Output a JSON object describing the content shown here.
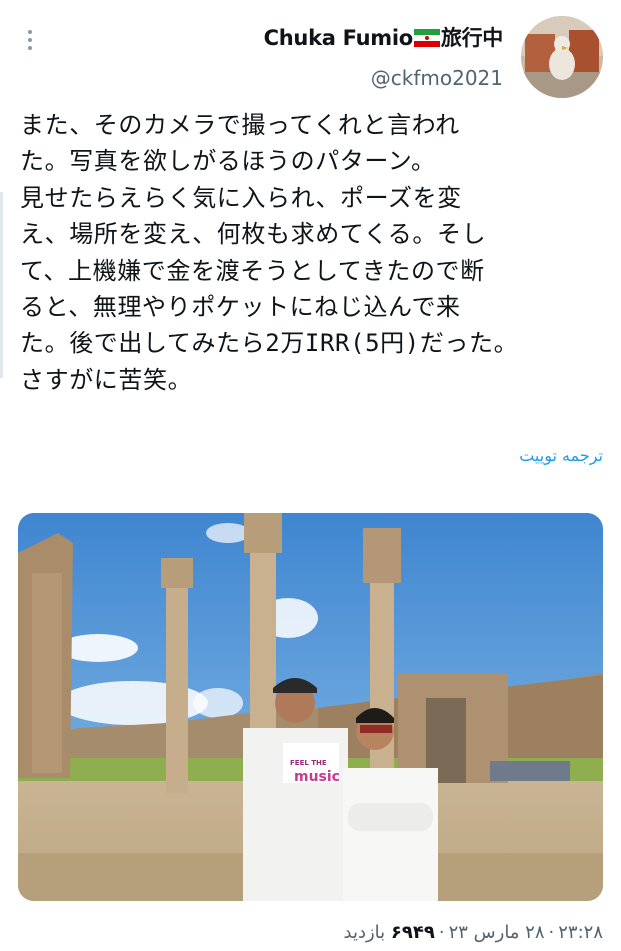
{
  "author": {
    "display_name": "Chuka Fumio",
    "display_suffix": "旅行中",
    "flag_icon": "iran-flag-icon",
    "handle": "@ckfmo2021"
  },
  "tweet": {
    "lines": [
      "また、そのカメラで撮ってくれと言われ",
      "た。写真を欲しがるほうのパターン。",
      "見せたらえらく気に入られ、ポーズを変",
      "え、場所を変え、何枚も求めてくる。そし",
      "て、上機嫌で金を渡そうとしてきたので断",
      "ると、無理やりポケットにねじ込んで来",
      "た。後で出してみたら2万IRR(5円)だった。",
      "さすがに苦笑。"
    ]
  },
  "translate_link": "ترجمه توییت",
  "photo": {
    "shirt_text_1": "FEEL THE",
    "shirt_text_2": "music"
  },
  "meta": {
    "time": "۲۳:۲۸",
    "date": "۲۸ مارس ۲۳",
    "views_count": "۶۹۴۹",
    "views_label": "بازدید"
  },
  "colors": {
    "text": "#0f1419",
    "secondary": "#536471",
    "link": "#1d9bf0",
    "background": "#ffffff"
  }
}
